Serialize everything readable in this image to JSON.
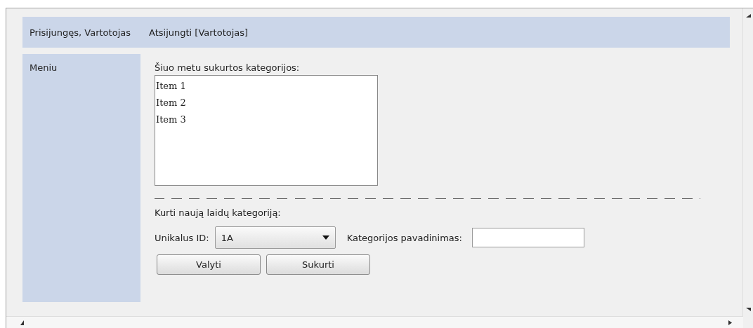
{
  "header": {
    "greeting": "Prisijungęs, Vartotojas",
    "logout_link": "Atsijungti [Vartotojas]"
  },
  "sidebar": {
    "title": "Meniu"
  },
  "categories": {
    "label": "Šiuo metu sukurtos kategorijos:",
    "items": [
      "Item 1",
      "Item 2",
      "Item 3"
    ]
  },
  "create_form": {
    "title": "Kurti naują laidų kategoriją:",
    "id_label": "Unikalus ID:",
    "id_value": "1A",
    "name_label": "Kategorijos pavadinimas:",
    "buttons": [
      "Valyti",
      "Sukurti"
    ]
  }
}
